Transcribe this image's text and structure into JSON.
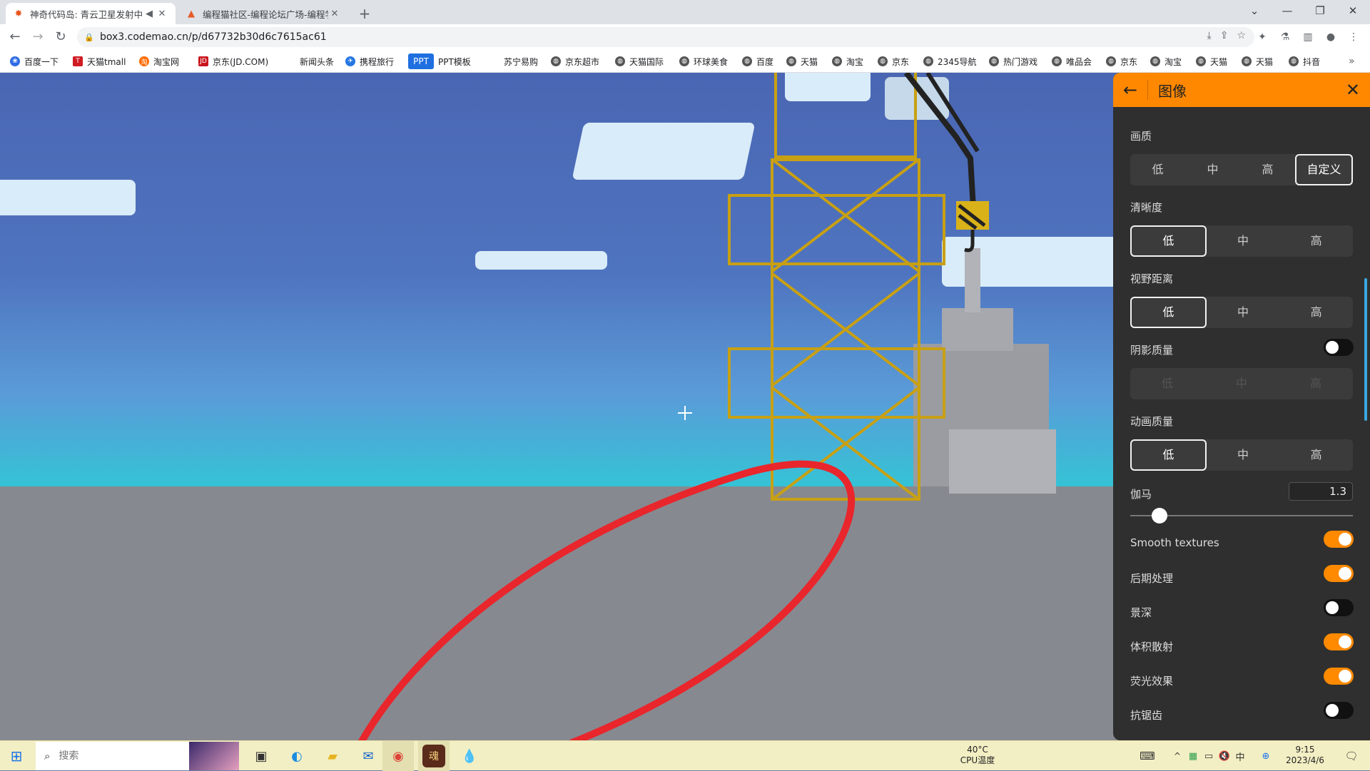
{
  "browser": {
    "tabs": [
      {
        "title": "神奇代码岛: 青云卫星发射中...",
        "active": true
      },
      {
        "title": "编程猫社区-编程论坛广场-编程学...",
        "active": false
      }
    ],
    "url": "box3.codemao.cn/p/d67732b30d6c7615ac61",
    "bookmarks": [
      "百度一下",
      "天猫tmall",
      "淘宝网",
      "京东(JD.COM)",
      "新闻头条",
      "携程旅行",
      "PPT模板",
      "苏宁易购",
      "京东超市",
      "天猫国际",
      "环球美食",
      "百度",
      "天猫",
      "淘宝",
      "京东",
      "2345导航",
      "热门游戏",
      "唯品会",
      "京东",
      "淘宝",
      "天猫",
      "天猫",
      "抖音"
    ]
  },
  "panel": {
    "title": "图像",
    "quality": {
      "label": "画质",
      "options": [
        "低",
        "中",
        "高",
        "自定义"
      ],
      "selected": 3
    },
    "resolution": {
      "label": "清晰度",
      "options": [
        "低",
        "中",
        "高"
      ],
      "selected": 0
    },
    "view_distance": {
      "label": "视野距离",
      "options": [
        "低",
        "中",
        "高"
      ],
      "selected": 0
    },
    "shadow": {
      "label": "阴影质量",
      "options": [
        "低",
        "中",
        "高"
      ],
      "enabled": false
    },
    "animation": {
      "label": "动画质量",
      "options": [
        "低",
        "中",
        "高"
      ],
      "selected": 0
    },
    "gamma": {
      "label": "伽马",
      "value": "1.3",
      "slider_fraction": 0.13
    },
    "toggles": [
      {
        "label": "Smooth textures",
        "on": true
      },
      {
        "label": "后期处理",
        "on": true
      },
      {
        "label": "景深",
        "on": false
      },
      {
        "label": "体积散射",
        "on": true
      },
      {
        "label": "荧光效果",
        "on": true
      },
      {
        "label": "抗锯齿",
        "on": false
      }
    ]
  },
  "taskbar": {
    "search_placeholder": "搜索",
    "cpu_temp": "40°C",
    "cpu_label": "CPU温度",
    "time": "9:15",
    "date": "2023/4/6"
  },
  "colors": {
    "accent": "#ff8800",
    "crane": "#c8a013",
    "ring": "#e8262c"
  }
}
